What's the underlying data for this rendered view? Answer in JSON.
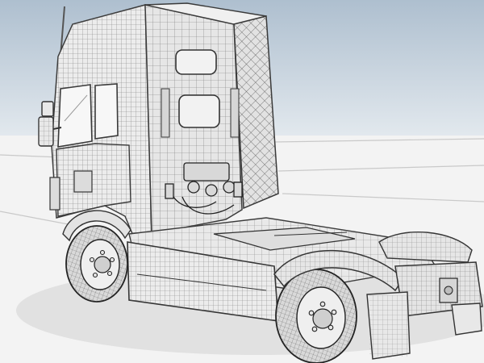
{
  "scene": {
    "subject": "truck-tractor-unit-wireframe-render",
    "colors": {
      "sky_top": "#aebfcf",
      "sky_bottom": "#e4eaef",
      "ground": "#f3f3f3",
      "body_fill": "#ececec",
      "body_shade": "#cfcfcf",
      "wire": "#6a6a6a",
      "wire_dense": "#3a3a3a",
      "tire": "#d9d9d9",
      "shadow": "#d2d2d2"
    }
  }
}
